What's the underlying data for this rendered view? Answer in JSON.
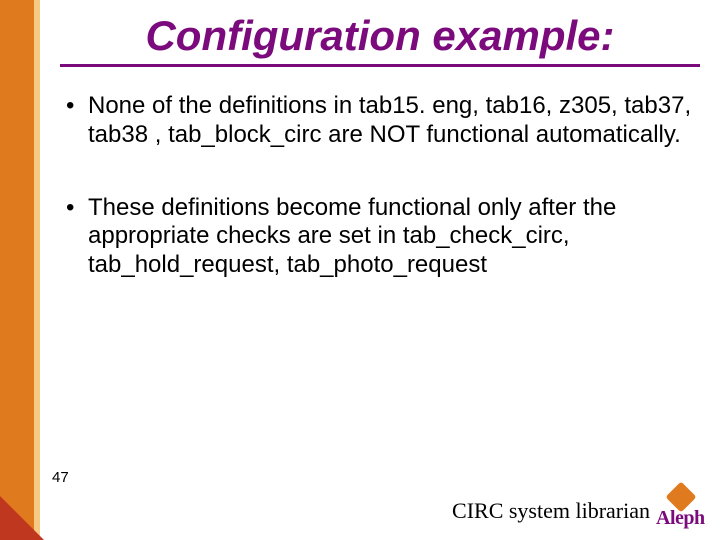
{
  "title": "Configuration example:",
  "bullets": [
    "None of the definitions in tab15. eng, tab16, z305, tab37, tab38 , tab_block_circ are NOT functional automatically.",
    "These definitions become functional only after the appropriate checks are set in tab_check_circ, tab_hold_request, tab_photo_request"
  ],
  "page_number": "47",
  "footer": "CIRC system librarian",
  "logo_text": "Aleph"
}
